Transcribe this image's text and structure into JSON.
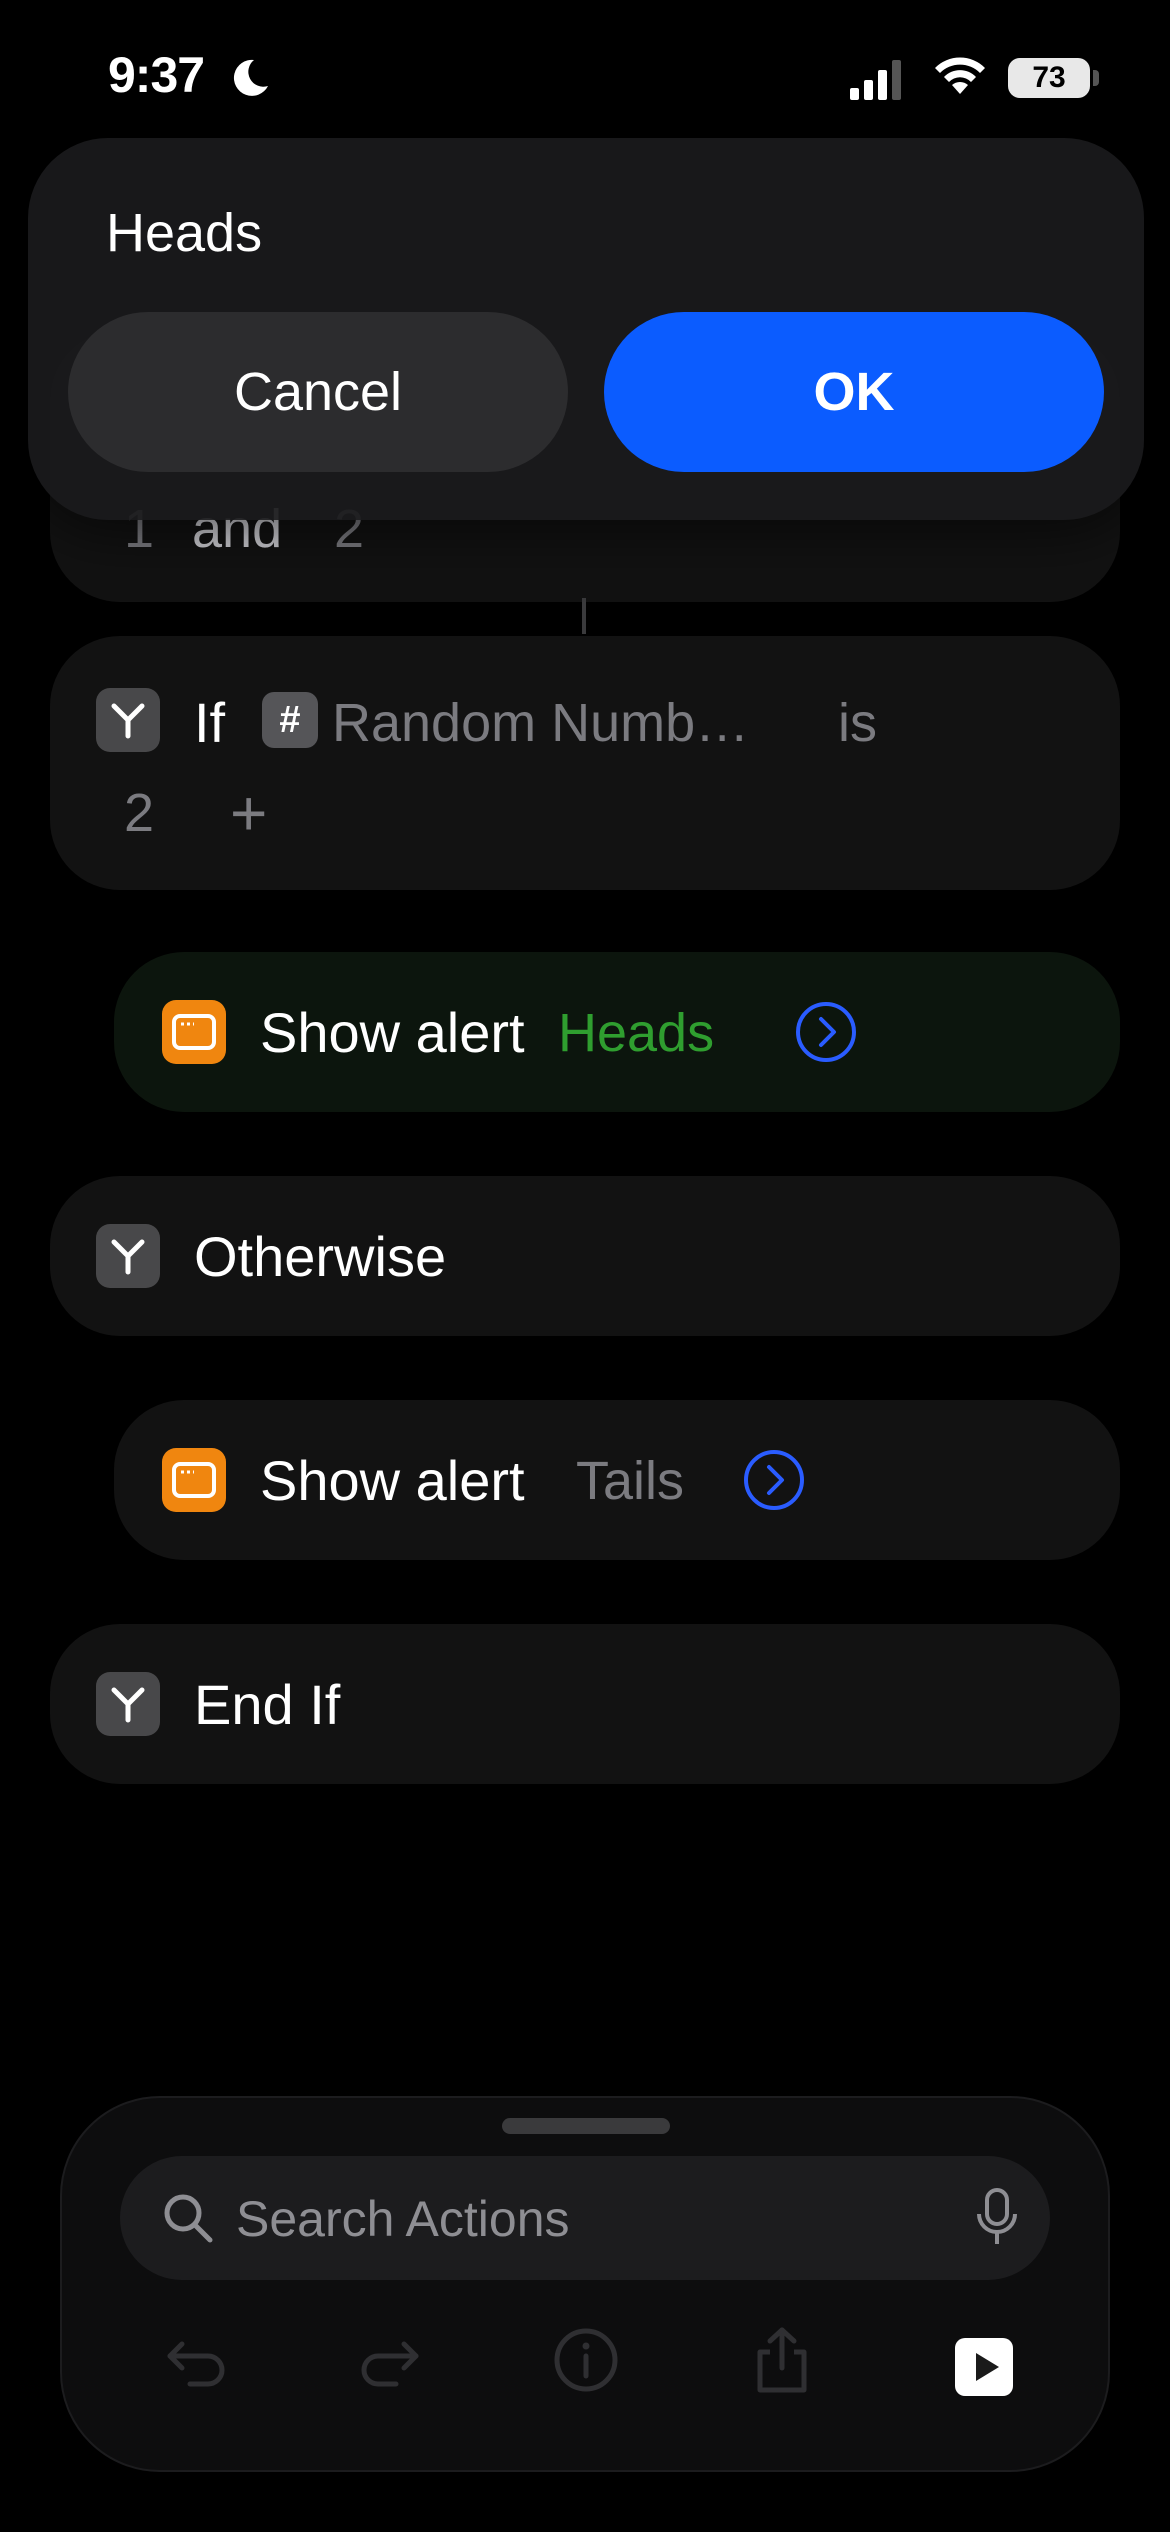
{
  "status": {
    "time": "9:37",
    "battery": "73"
  },
  "alert": {
    "message": "Heads",
    "cancel_label": "Cancel",
    "ok_label": "OK",
    "ok_color": "#0b5cff"
  },
  "background_step": {
    "text_a": "1",
    "text_and": "and",
    "text_b": "2"
  },
  "if_block": {
    "keyword": "If",
    "variable": "Random Numb…",
    "operator": "is",
    "value": "2",
    "add_symbol": "+"
  },
  "show_alert_heads": {
    "label": "Show alert",
    "token": "Heads",
    "token_color": "#2f9e2f"
  },
  "otherwise": {
    "label": "Otherwise"
  },
  "show_alert_tails": {
    "label": "Show alert",
    "token": "Tails"
  },
  "end_if": {
    "label": "End If"
  },
  "search": {
    "placeholder": "Search Actions"
  },
  "icons": {
    "branch": "branch-icon",
    "alert": "alert-window-icon",
    "chevron": "chevron-right-circle-icon",
    "undo": "undo-icon",
    "redo": "redo-icon",
    "info": "info-icon",
    "share": "share-icon",
    "play": "play-icon"
  }
}
